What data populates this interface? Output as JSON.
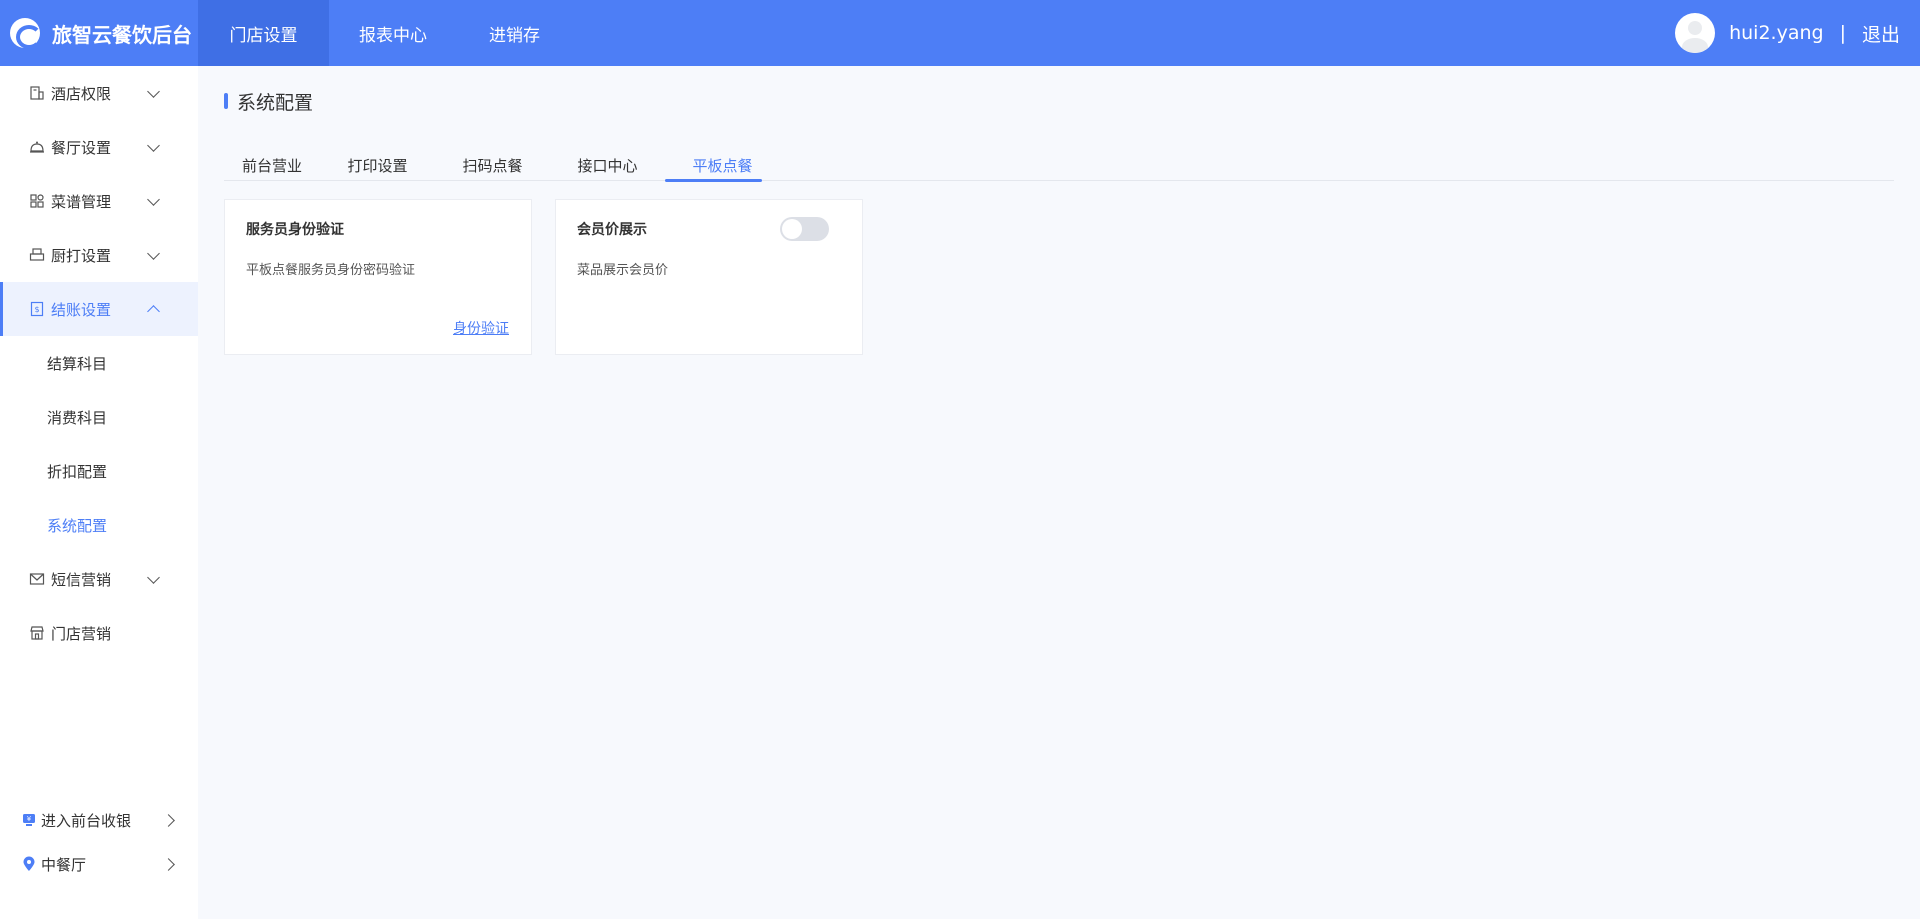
{
  "header": {
    "brand": "旅智云餐饮后台",
    "nav": [
      "门店设置",
      "报表中心",
      "进销存"
    ],
    "username": "hui2.yang",
    "separator": "|",
    "logout": "退出"
  },
  "sidebar": {
    "items": [
      {
        "label": "酒店权限",
        "icon": "building-icon"
      },
      {
        "label": "餐厅设置",
        "icon": "cloche-icon"
      },
      {
        "label": "菜谱管理",
        "icon": "grid-icon"
      },
      {
        "label": "厨打设置",
        "icon": "printer-icon"
      },
      {
        "label": "结账设置",
        "icon": "receipt-icon"
      }
    ],
    "sub_items": [
      "结算科目",
      "消费科目",
      "折扣配置",
      "系统配置"
    ],
    "items_after": [
      {
        "label": "短信营销",
        "icon": "mail-icon"
      },
      {
        "label": "门店营销",
        "icon": "store-icon"
      }
    ],
    "bottom": [
      {
        "label": "进入前台收银",
        "icon": "cashier-icon"
      },
      {
        "label": "中餐厅",
        "icon": "location-icon"
      }
    ]
  },
  "main": {
    "title": "系统配置",
    "tabs": [
      "前台营业",
      "打印设置",
      "扫码点餐",
      "接口中心",
      "平板点餐"
    ],
    "cards": [
      {
        "title": "服务员身份验证",
        "desc": "平板点餐服务员身份密码验证",
        "link": "身份验证"
      },
      {
        "title": "会员价展示",
        "desc": "菜品展示会员价",
        "toggle_on": false
      }
    ]
  },
  "colors": {
    "accent": "#4d7ef6",
    "header": "#4d7ef6",
    "background": "#f7f9fd"
  }
}
